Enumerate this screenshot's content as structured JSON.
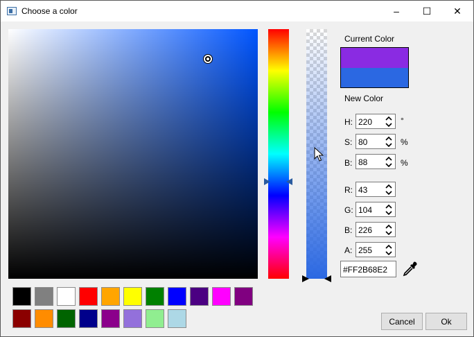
{
  "window": {
    "title": "Choose a color",
    "minimize": "–",
    "maximize": "☐",
    "close": "✕"
  },
  "picker": {
    "hue": 220,
    "saturation": 80,
    "brightness": 88,
    "alpha_fraction": 1.0
  },
  "current_color": {
    "label": "Current Color",
    "top": "#8a2be2",
    "bottom": "#2b68e2"
  },
  "new_color": {
    "label": "New Color"
  },
  "fields": {
    "h": {
      "label": "H:",
      "value": "220",
      "unit": "°"
    },
    "s": {
      "label": "S:",
      "value": "80",
      "unit": "%"
    },
    "b": {
      "label": "B:",
      "value": "88",
      "unit": "%"
    },
    "r": {
      "label": "R:",
      "value": "43"
    },
    "g": {
      "label": "G:",
      "value": "104"
    },
    "bl": {
      "label": "B:",
      "value": "226"
    },
    "a": {
      "label": "A:",
      "value": "255"
    }
  },
  "hex": "#FF2B68E2",
  "palette": [
    "#000000",
    "#808080",
    "#ffffff",
    "#ff0000",
    "#ffa500",
    "#ffff00",
    "#008000",
    "#0000ff",
    "#4b0082",
    "#ff00ff",
    "#800080",
    "#8b0000",
    "#ff8c00",
    "#006400",
    "#00008b",
    "#8b008b",
    "#9370db",
    "#90ee90",
    "#add8e6"
  ],
  "buttons": {
    "cancel": "Cancel",
    "ok": "Ok"
  }
}
